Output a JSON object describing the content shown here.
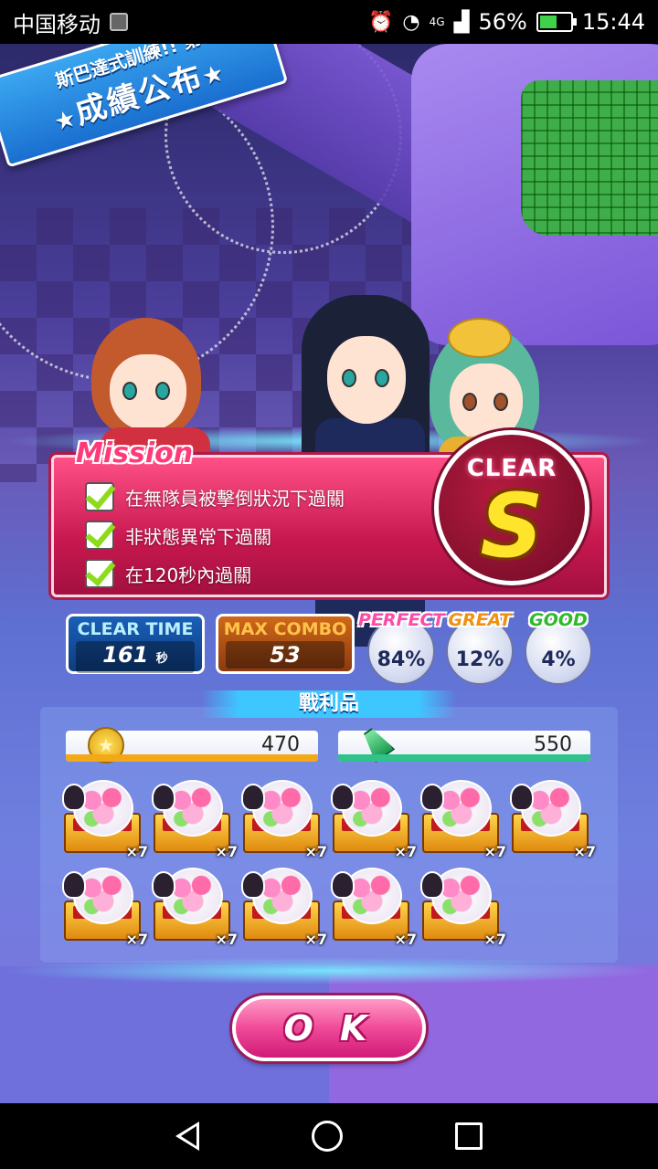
{
  "status_bar": {
    "carrier": "中国移动",
    "network": "4G",
    "battery": "56%",
    "battery_level": 0.56,
    "time": "15:44",
    "icons": [
      "image-icon",
      "alarm-icon",
      "wifi-icon",
      "signal-icon",
      "battery-icon"
    ]
  },
  "banner": {
    "subtitle": "斯巴達式訓練!! 第",
    "title": "成績公布"
  },
  "mission": {
    "title": "Mission",
    "items": [
      "在無隊員被擊倒狀況下過關",
      "非狀態異常下過關",
      "在120秒內過關"
    ],
    "rank_label": "CLEAR",
    "rank_value": "S"
  },
  "stats": {
    "clear_time_label": "CLEAR TIME",
    "clear_time_value": "161",
    "clear_time_unit": "秒",
    "max_combo_label": "MAX COMBO",
    "max_combo_value": "53",
    "perfect_label": "PERFECT",
    "perfect_value": "84%",
    "great_label": "GREAT",
    "great_value": "12%",
    "good_label": "GOOD",
    "good_value": "4%"
  },
  "rewards": {
    "header": "戰利品",
    "coins": "470",
    "green": "550",
    "items": [
      {
        "qty": "×7"
      },
      {
        "qty": "×7"
      },
      {
        "qty": "×7"
      },
      {
        "qty": "×7"
      },
      {
        "qty": "×7"
      },
      {
        "qty": "×7"
      },
      {
        "qty": "×7"
      },
      {
        "qty": "×7"
      },
      {
        "qty": "×7"
      },
      {
        "qty": "×7"
      },
      {
        "qty": "×7"
      }
    ]
  },
  "ok_button": "O K"
}
